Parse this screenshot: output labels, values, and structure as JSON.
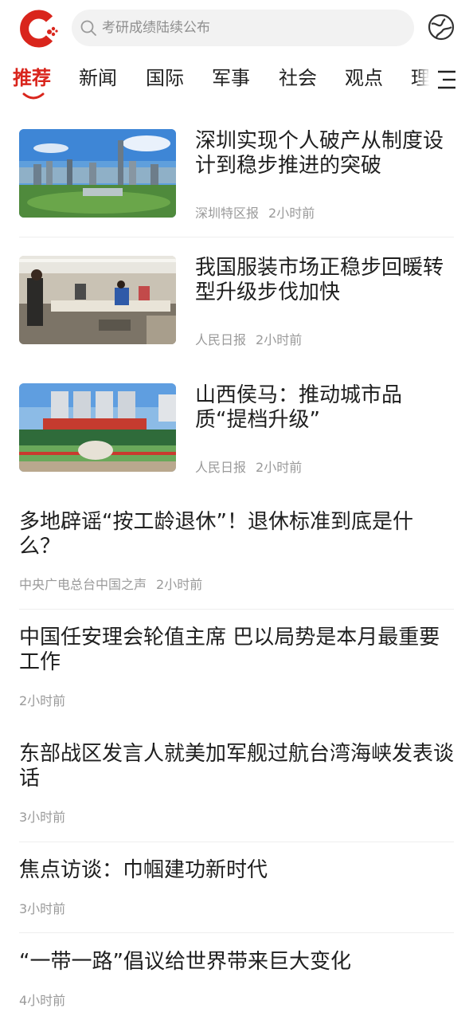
{
  "header": {
    "search_placeholder": "考研成绩陆续公布"
  },
  "tabs": [
    "推荐",
    "新闻",
    "国际",
    "军事",
    "社会",
    "观点",
    "理"
  ],
  "articles": [
    {
      "title": "深圳实现个人破产从制度设计到稳步推进的突破",
      "source": "深圳特区报",
      "time": "2小时前",
      "image": "city-skyline"
    },
    {
      "title": "我国服装市场正稳步回暖转型升级步伐加快",
      "source": "人民日报",
      "time": "2小时前",
      "image": "garment-factory"
    },
    {
      "title": "山西侯马：推动城市品质“提档升级”",
      "source": "人民日报",
      "time": "2小时前",
      "image": "city-plaza"
    },
    {
      "title": "多地辟谣“按工龄退休”！退休标准到底是什么？",
      "source": "中央广电总台中国之声",
      "time": "2小时前"
    },
    {
      "title": "中国任安理会轮值主席 巴以局势是本月最重要工作",
      "time": "2小时前"
    },
    {
      "title": "东部战区发言人就美加军舰过航台湾海峡发表谈话",
      "time": "3小时前"
    },
    {
      "title": "焦点访谈：巾帼建功新时代",
      "time": "3小时前"
    },
    {
      "title": "“一带一路”倡议给世界带来巨大变化",
      "time": "4小时前"
    }
  ],
  "colors": {
    "accent": "#d9251c",
    "meta_gray": "#9a9a9a"
  }
}
